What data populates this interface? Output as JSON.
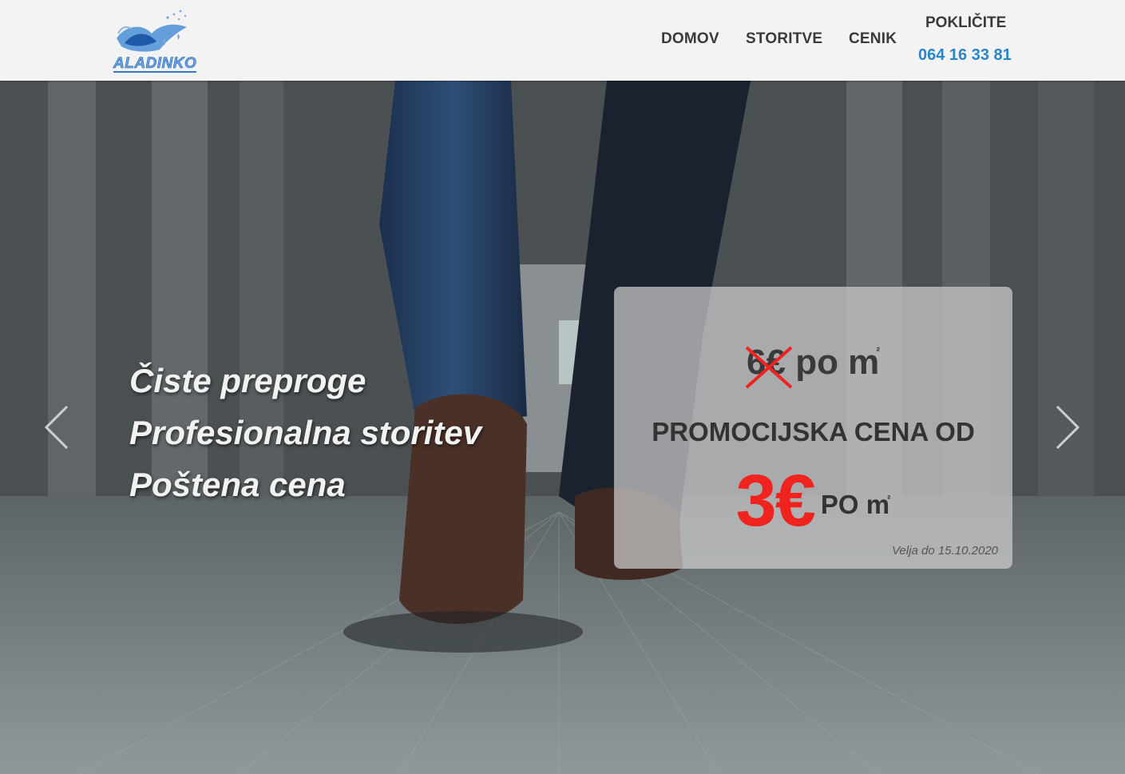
{
  "header": {
    "logo_text": "ALADINKO",
    "nav": [
      {
        "label": "DOMOV"
      },
      {
        "label": "STORITVE"
      },
      {
        "label": "CENIK"
      }
    ],
    "call_label": "POKLIČITE",
    "phone": "064 16 33 81"
  },
  "hero": {
    "taglines": [
      "Čiste preproge",
      "Profesionalna storitev",
      "Poštena cena"
    ],
    "promo": {
      "old_price_value": "6€",
      "old_price_unit": "po m",
      "old_price_sup": "²",
      "label": "PROMOCIJSKA CENA OD",
      "new_price_value": "3€",
      "new_price_unit": "PO m",
      "new_price_sup": "²",
      "valid_until": "Velja do 15.10.2020"
    }
  },
  "colors": {
    "header_bg": "#f3f3f3",
    "nav_text": "#3a3a3a",
    "phone": "#2a86c8",
    "promo_price": "#f0231e"
  },
  "icons": {
    "logo": "genie-lamp-logo",
    "prev": "chevron-left-icon",
    "next": "chevron-right-icon",
    "strike": "x-mark-icon"
  }
}
